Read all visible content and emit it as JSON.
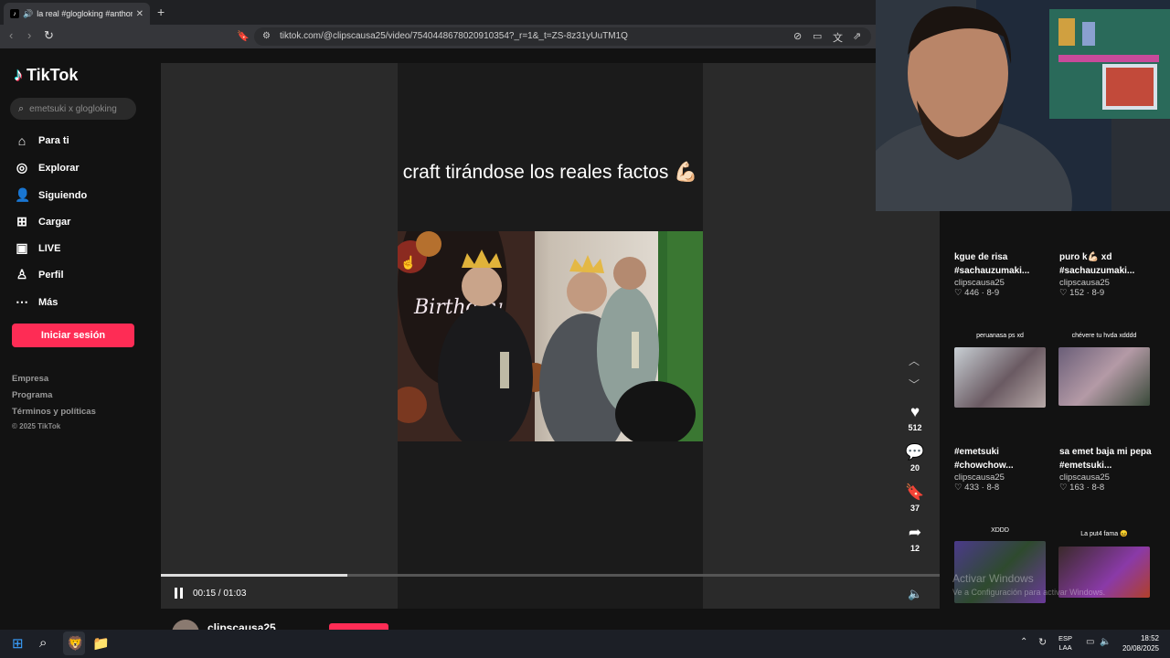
{
  "browser": {
    "tab_title": "la real #glogloking #anthony...",
    "url": "tiktok.com/@clipscausa25/video/7540448678020910354?_r=1&_t=ZS-8z31yUuTM1Q"
  },
  "tiktok": {
    "logo": "TikTok",
    "search_placeholder": "emetsuki x glogloking",
    "nav": [
      {
        "label": "Para ti",
        "icon": "home-icon"
      },
      {
        "label": "Explorar",
        "icon": "compass-icon"
      },
      {
        "label": "Siguiendo",
        "icon": "following-icon"
      },
      {
        "label": "Cargar",
        "icon": "upload-icon"
      },
      {
        "label": "LIVE",
        "icon": "live-icon"
      },
      {
        "label": "Perfil",
        "icon": "profile-icon"
      },
      {
        "label": "Más",
        "icon": "more-icon"
      }
    ],
    "login_button": "Iniciar sesión",
    "footer_links": [
      "Empresa",
      "Programa",
      "Términos y políticas"
    ],
    "copyright": "© 2025 TikTok"
  },
  "video": {
    "caption": "craft tirándose los reales factos 💪🏻",
    "current_time": "00:15",
    "duration": "01:03",
    "time_display": "00:15 / 01:03",
    "progress_fraction": 0.24,
    "likes": "512",
    "comments": "20",
    "saves": "37",
    "shares": "12",
    "author": "clipscausa25"
  },
  "related": [
    {
      "title": "kgue de risa #sachauzumaki...",
      "user": "clipscausa25",
      "meta": "♡ 446 · 8-9"
    },
    {
      "title": "puro k💪🏻 xd #sachauzumaki...",
      "user": "clipscausa25",
      "meta": "♡ 152 · 8-9"
    },
    {
      "thumb_caption": "peruanasa ps xd"
    },
    {
      "thumb_caption": "chévere tu hvda xdddd"
    },
    {
      "title": "#emetsuki #chowchow...",
      "user": "clipscausa25",
      "meta": "♡ 433 · 8-8"
    },
    {
      "title": "sa emet baja mi pepa #emetsuki...",
      "user": "clipscausa25",
      "meta": "♡ 163 · 8-8"
    },
    {
      "thumb_caption": "XDDD"
    },
    {
      "thumb_caption": "La put4 fama 😖"
    }
  ],
  "watermark": {
    "line1": "Activar Windows",
    "line2": "Ve a Configuración para activar Windows."
  },
  "taskbar": {
    "lang": "ESP",
    "layout": "LAA",
    "time": "18:52",
    "date": "20/08/2025"
  },
  "colors": {
    "accent": "#fe2c55",
    "background": "#121212"
  }
}
